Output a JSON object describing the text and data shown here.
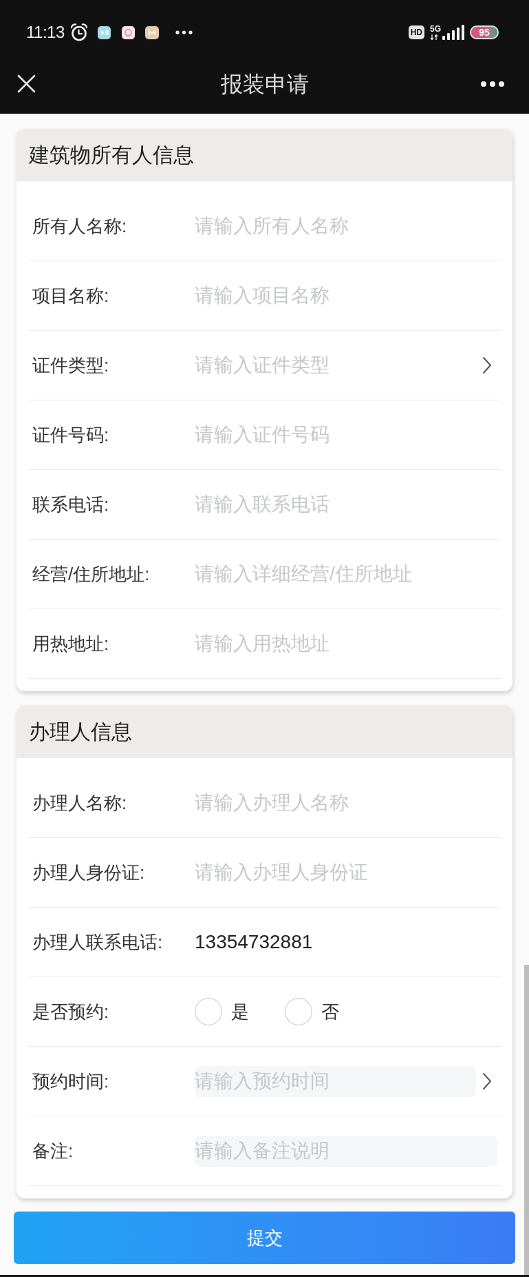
{
  "status_bar": {
    "time": "11:13",
    "hd": "HD",
    "network": "5G",
    "battery": "95"
  },
  "nav": {
    "title": "报装申请"
  },
  "sections": [
    {
      "title": "建筑物所有人信息",
      "rows": [
        {
          "kind": "input",
          "label": "所有人名称:",
          "placeholder": "请输入所有人名称"
        },
        {
          "kind": "input",
          "label": "项目名称:",
          "placeholder": "请输入项目名称"
        },
        {
          "kind": "select",
          "label": "证件类型:",
          "placeholder": "请输入证件类型"
        },
        {
          "kind": "input",
          "label": "证件号码:",
          "placeholder": "请输入证件号码"
        },
        {
          "kind": "input",
          "label": "联系电话:",
          "placeholder": "请输入联系电话"
        },
        {
          "kind": "input",
          "label": "经营/住所地址:",
          "placeholder": "请输入详细经营/住所地址"
        },
        {
          "kind": "input",
          "label": "用热地址:",
          "placeholder": "请输入用热地址"
        }
      ]
    },
    {
      "title": "办理人信息",
      "rows": [
        {
          "kind": "input",
          "label": "办理人名称:",
          "placeholder": "请输入办理人名称"
        },
        {
          "kind": "input",
          "label": "办理人身份证:",
          "placeholder": "请输入办理人身份证"
        },
        {
          "kind": "input",
          "label": "办理人联系电话:",
          "value": "13354732881"
        },
        {
          "kind": "radio",
          "label": "是否预约:",
          "options": [
            {
              "label": "是",
              "selected": false
            },
            {
              "label": "否",
              "selected": false
            }
          ]
        },
        {
          "kind": "datetime",
          "label": "预约时间:",
          "placeholder": "请输入预约时间"
        },
        {
          "kind": "textarea",
          "label": "备注:",
          "placeholder": "请输入备注说明"
        }
      ]
    }
  ],
  "submit": {
    "label": "提交"
  }
}
